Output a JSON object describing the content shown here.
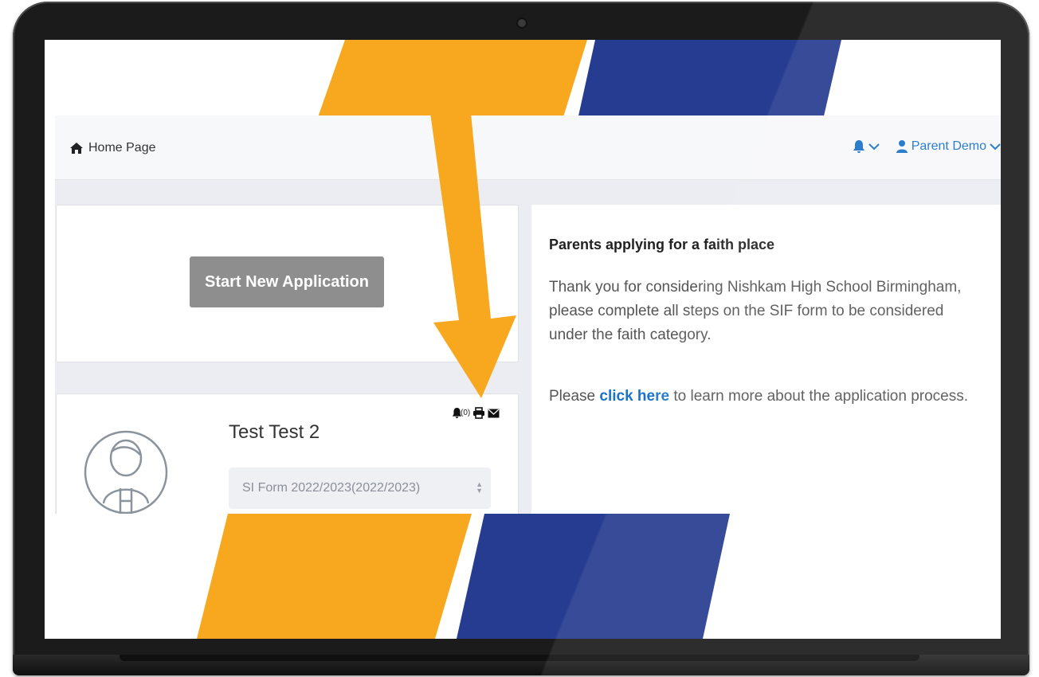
{
  "nav": {
    "home_label": "Home Page",
    "user_label": "Parent Demo"
  },
  "start_card": {
    "button_label": "Start New Application"
  },
  "child_card": {
    "name": "Test Test 2",
    "notification_count": "(0)",
    "form_selected": "SI Form 2022/2023(2022/2023)"
  },
  "info": {
    "heading": "Parents applying for a faith place",
    "paragraph1": "Thank you for considering Nishkam High School Birmingham, please complete all steps on the SIF form to be considered under the faith category.",
    "paragraph2_before": "Please",
    "link_label": "click here",
    "paragraph2_after": "to learn more about the application process."
  },
  "colors": {
    "accent_orange": "#f7a81f",
    "accent_blue": "#263c90",
    "link_blue": "#1a73c8",
    "button_gray": "#8e8e8e"
  },
  "icons": [
    "home-icon",
    "bell-icon",
    "chevron-down-icon",
    "user-icon",
    "print-icon",
    "envelope-icon",
    "avatar-icon",
    "arrow-icon"
  ]
}
